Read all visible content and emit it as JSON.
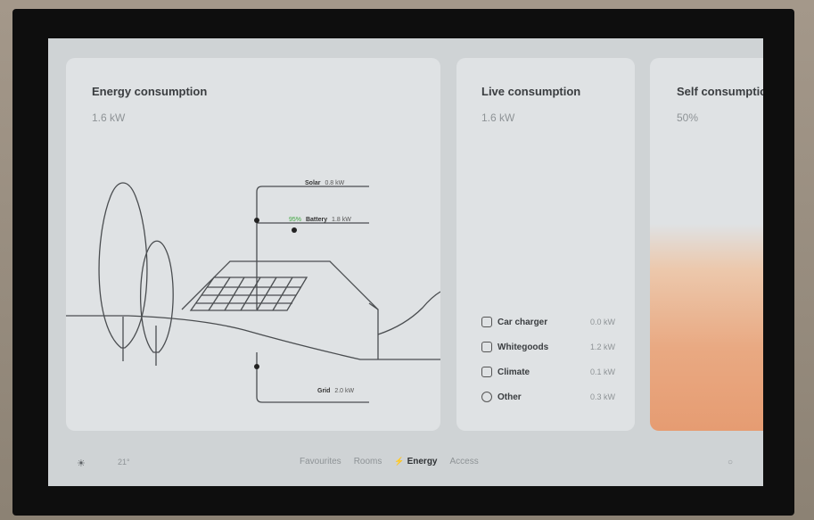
{
  "cards": {
    "energy": {
      "title": "Energy consumption",
      "value": "1.6 kW"
    },
    "live": {
      "title": "Live consumption",
      "value": "1.6 kW"
    },
    "self": {
      "title": "Self consumption",
      "value": "50%"
    }
  },
  "diagram": {
    "solar": {
      "label": "Solar",
      "value": "0.8 kW"
    },
    "battery": {
      "label": "Battery",
      "value": "1.8 kW",
      "percent": "95%"
    },
    "grid": {
      "label": "Grid",
      "value": "2.0 kW"
    }
  },
  "live_items": [
    {
      "icon": "car-charger-icon",
      "label": "Car charger",
      "value": "0.0 kW"
    },
    {
      "icon": "whitegoods-icon",
      "label": "Whitegoods",
      "value": "1.2 kW"
    },
    {
      "icon": "climate-icon",
      "label": "Climate",
      "value": "0.1 kW"
    },
    {
      "icon": "other-icon",
      "label": "Other",
      "value": "0.3 kW"
    }
  ],
  "nav": {
    "left_text": "21°",
    "tabs": [
      "Favourites",
      "Rooms",
      "Energy",
      "Access"
    ],
    "active_tab": "Energy"
  },
  "colors": {
    "accent_battery": "#3fa63f",
    "self_fill": "#e69c72"
  }
}
